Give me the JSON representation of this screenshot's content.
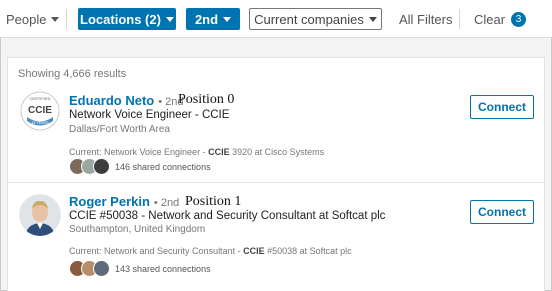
{
  "filters": {
    "people_label": "People",
    "locations_label": "Locations (2)",
    "degree_label": "2nd",
    "current_companies_label": "Current companies",
    "all_filters_label": "All Filters",
    "clear_label": "Clear",
    "clear_count": "3"
  },
  "results": {
    "count_text": "Showing 4,666 results",
    "items": [
      {
        "name": "Eduardo Neto",
        "degree": "• 2nd",
        "position_note": "Position 0",
        "headline": "Network Voice Engineer - CCIE",
        "location": "Dallas/Fort Worth Area",
        "current_prefix": "Current: Network Voice Engineer -",
        "current_highlight": "CCIE",
        "current_suffix": "3920 at Cisco Systems",
        "shared": "146 shared connections",
        "connect_label": "Connect",
        "avatar_text": "CCIE",
        "avatar_top": "CERTIFIED",
        "avatar_bottom": "15 YEARS"
      },
      {
        "name": "Roger Perkin",
        "degree": "• 2nd",
        "position_note": "Position 1",
        "headline": "CCIE #50038 - Network and Security Consultant at Softcat plc",
        "location": "Southampton, United Kingdom",
        "current_prefix": "Current: Network and Security Consultant -",
        "current_highlight": "CCIE",
        "current_suffix": "#50038 at Softcat plc",
        "shared": "143 shared connections",
        "connect_label": "Connect"
      }
    ]
  },
  "colors": {
    "accent": "#0073b1",
    "background": "#f3f3f3"
  }
}
